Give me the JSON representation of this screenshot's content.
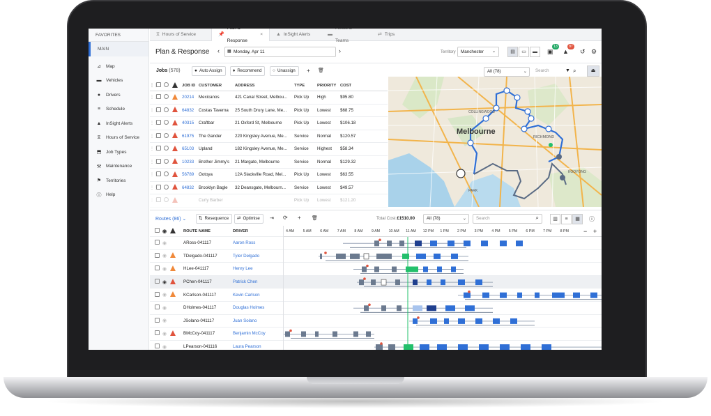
{
  "sidebar": {
    "favorites": "FAVORITES",
    "main": "MAIN",
    "items": [
      {
        "label": "Map",
        "icon": "map-icon"
      },
      {
        "label": "Vehicles",
        "icon": "truck-icon"
      },
      {
        "label": "Drivers",
        "icon": "person-icon"
      },
      {
        "label": "Schedule",
        "icon": "list-icon"
      },
      {
        "label": "InSight Alerts",
        "icon": "alert-icon"
      },
      {
        "label": "Hours of Service",
        "icon": "clock-icon"
      },
      {
        "label": "Job Types",
        "icon": "tag-icon"
      },
      {
        "label": "Maintenance",
        "icon": "wrench-icon"
      },
      {
        "label": "Territories",
        "icon": "flag-icon"
      },
      {
        "label": "Help",
        "icon": "info-icon"
      }
    ]
  },
  "tabs": [
    {
      "label": "Hours of Service",
      "icon": "clock-icon"
    },
    {
      "label": "Plan & Response",
      "icon": "pin-icon",
      "close": "×"
    },
    {
      "label": "InSight Alerts",
      "icon": "alert-icon"
    },
    {
      "label": "Fleets & Teams",
      "icon": "truck-icon"
    },
    {
      "label": "Trips",
      "icon": "route-icon"
    }
  ],
  "header": {
    "title": "Plan & Response",
    "prev": "‹",
    "next": "›",
    "date": "Monday, Apr 11",
    "territory_label": "Territory",
    "territory": "Manchester",
    "badge1": "13",
    "badge2": "87"
  },
  "jobs": {
    "title": "Jobs",
    "count": "(578)",
    "auto_assign": "Auto Assign",
    "recommend": "Recommend",
    "unassign": "Unassign",
    "add": "+",
    "columns": [
      "JOB ID",
      "CUSTOMER",
      "ADDRESS",
      "TYPE",
      "PRIORITY",
      "COST"
    ],
    "rows": [
      {
        "id": "20214",
        "customer": "Mexicanos",
        "address": "421 Canal Street, Melbou...",
        "type": "Pick Up",
        "priority": "High",
        "cost": "$95.80",
        "warn": "orange"
      },
      {
        "id": "64832",
        "customer": "Costas Taverna",
        "address": "25 South Drury Lane, Me...",
        "type": "Pick Up",
        "priority": "Lowest",
        "cost": "$68.75",
        "warn": "red"
      },
      {
        "id": "40315",
        "customer": "Craftbar",
        "address": "21 Oxford St, Melbourne",
        "type": "Pick Up",
        "priority": "Lowest",
        "cost": "$106.18",
        "warn": "red"
      },
      {
        "id": "61975",
        "customer": "The Gander",
        "address": "220 Kingsley Avenue, Me...",
        "type": "Service",
        "priority": "Normal",
        "cost": "$120.57",
        "warn": "red"
      },
      {
        "id": "65103",
        "customer": "Upland",
        "address": "182 Kingsley Avenue, Me...",
        "type": "Service",
        "priority": "Highest",
        "cost": "$58.34",
        "warn": "red"
      },
      {
        "id": "10233",
        "customer": "Brother Jimmy's",
        "address": "21 Margate, Melbourne",
        "type": "Service",
        "priority": "Normal",
        "cost": "$129.32",
        "warn": "red"
      },
      {
        "id": "56789",
        "customer": "Ootoya",
        "address": "12A Slackville Road, Mel...",
        "type": "Pick Up",
        "priority": "Lowest",
        "cost": "$63.55",
        "warn": "red"
      },
      {
        "id": "64832",
        "customer": "Brooklyn Bagle",
        "address": "32 Deansgate, Melbourn...",
        "type": "Service",
        "priority": "Lowest",
        "cost": "$49.57",
        "warn": "red"
      },
      {
        "id": "",
        "customer": "Curly Barber",
        "address": "",
        "type": "Pick Up",
        "priority": "Lowest",
        "cost": "$121.20",
        "warn": "red"
      }
    ]
  },
  "map": {
    "city": "Melbourne",
    "suburbs": [
      "COLLINGWOOD",
      "RICHMOND",
      "KOOYONG",
      "PARK"
    ],
    "filter": "All (78)",
    "search_placeholder": "Search"
  },
  "routes": {
    "title": "Routes",
    "count": "(86)",
    "resequence": "Resequence",
    "optimise": "Optimise",
    "total_cost_label": "Total Cost",
    "total_cost": "£1510.00",
    "filter": "All (78)",
    "search_placeholder": "Search",
    "columns": [
      "ROUTE NAME",
      "DRIVER"
    ],
    "times": [
      "4 AM",
      "5 AM",
      "6 AM",
      "7 AM",
      "8 AM",
      "9 AM",
      "10 AM",
      "11 AM",
      "12 PM",
      "1 PM",
      "2 PM",
      "3 PM",
      "4 PM",
      "5 PM",
      "6 PM",
      "7 PM",
      "8 PM"
    ],
    "rows": [
      {
        "name": "ARoss-041117",
        "driver": "Aaron Ross",
        "warn": "none"
      },
      {
        "name": "TDelgado-041117",
        "driver": "Tyler Delgado",
        "warn": "orange"
      },
      {
        "name": "HLee-041117",
        "driver": "Henry Lee",
        "warn": "orange"
      },
      {
        "name": "PChen-041117",
        "driver": "Patrick Chen",
        "warn": "red"
      },
      {
        "name": "KCarlson-041117",
        "driver": "Kevin Carlson",
        "warn": "orange"
      },
      {
        "name": "DHolmes-041117",
        "driver": "Douglas Holmes",
        "warn": "none"
      },
      {
        "name": "JSolano-041117",
        "driver": "Juan Solano",
        "warn": "none"
      },
      {
        "name": "BMcCoy-041117",
        "driver": "Benjamin McCoy",
        "warn": "red"
      },
      {
        "name": "LPearson-041116",
        "driver": "Laura Pearson",
        "warn": "none"
      }
    ]
  },
  "colors": {
    "accent": "#2f6fd6",
    "warning": "#e0533d",
    "alert_orange": "#f0893a",
    "current": "#22c06b"
  }
}
